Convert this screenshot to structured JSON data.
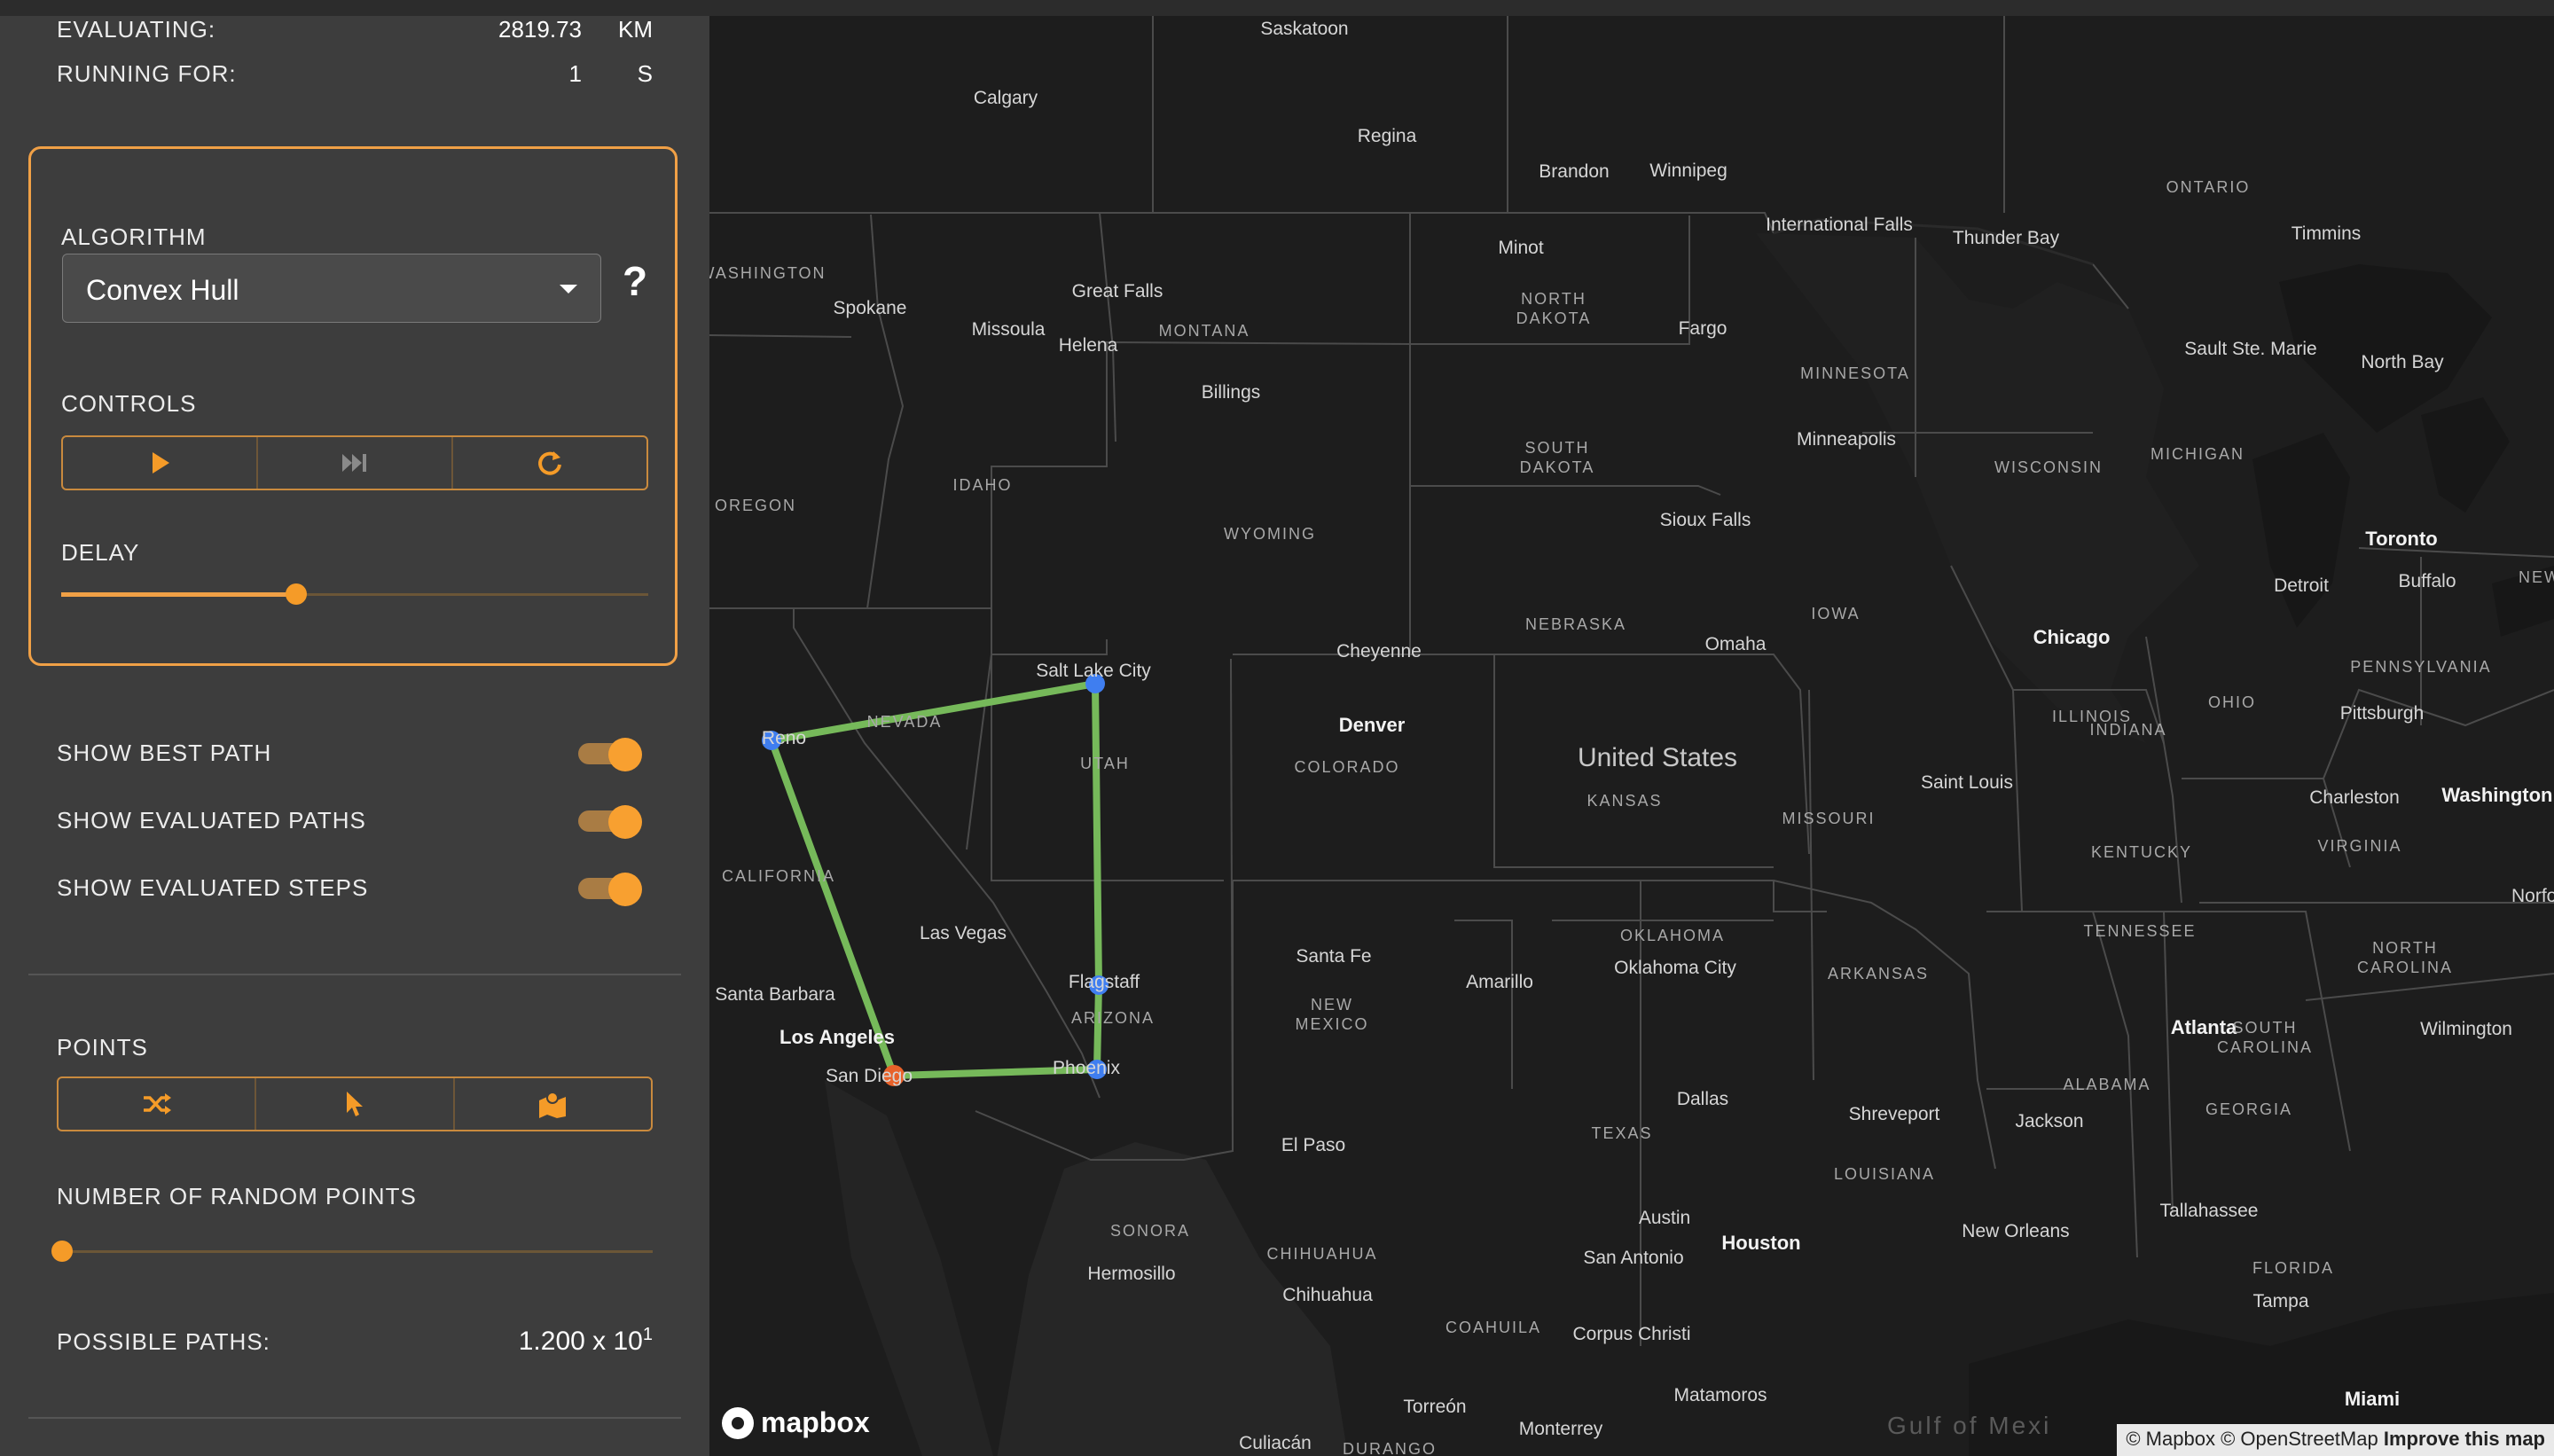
{
  "stats": {
    "evaluating_label": "EVALUATING:",
    "evaluating_value": "2819.73",
    "evaluating_unit": "KM",
    "running_label": "RUNNING FOR:",
    "running_value": "1",
    "running_unit": "S"
  },
  "algorithm": {
    "label": "ALGORITHM",
    "selected": "Convex Hull",
    "help": "?"
  },
  "controls": {
    "label": "CONTROLS",
    "buttons": [
      {
        "icon": "play-icon"
      },
      {
        "icon": "step-forward-icon"
      },
      {
        "icon": "restart-icon"
      }
    ]
  },
  "delay": {
    "label": "DELAY",
    "fraction": 0.4
  },
  "toggles": [
    {
      "label": "SHOW BEST PATH",
      "on": true
    },
    {
      "label": "SHOW EVALUATED PATHS",
      "on": true
    },
    {
      "label": "SHOW EVALUATED STEPS",
      "on": true
    }
  ],
  "points": {
    "label": "POINTS",
    "buttons": [
      {
        "icon": "shuffle-icon"
      },
      {
        "icon": "cursor-icon"
      },
      {
        "icon": "map-pins-icon"
      }
    ]
  },
  "random_points": {
    "label": "NUMBER OF RANDOM POINTS",
    "fraction": 0.0
  },
  "possible_paths": {
    "label": "POSSIBLE PATHS:",
    "mantissa": "1.200 x 10",
    "exponent": "1"
  },
  "map": {
    "country": "United States",
    "water": "Gulf of Mexi",
    "logo": "mapbox",
    "attribution": {
      "mapbox": "© Mapbox",
      "osm": "© OpenStreetMap",
      "improve": "Improve this map"
    },
    "cities": [
      "Saskatoon",
      "Calgary",
      "Regina",
      "Brandon",
      "Winnipeg",
      "Minot",
      "International Falls",
      "Thunder Bay",
      "Timmins",
      "Spokane",
      "Great Falls",
      "Missoula",
      "Helena",
      "Billings",
      "Fargo",
      "Sault Ste. Marie",
      "North Bay",
      "Minneapolis",
      "Sioux Falls",
      "Toronto",
      "Detroit",
      "Buffalo",
      "Salt Lake City",
      "Cheyenne",
      "Omaha",
      "Chicago",
      "Pittsburgh",
      "Denver",
      "Reno",
      "Saint Louis",
      "Charleston",
      "Washington D.",
      "Las Vegas",
      "Santa Fe",
      "Amarillo",
      "Oklahoma City",
      "Norfol",
      "Santa Barbara",
      "Flagstaff",
      "Los Angeles",
      "San Diego",
      "Phoenix",
      "Atlanta",
      "Wilmington",
      "Dallas",
      "Shreveport",
      "Jackson",
      "El Paso",
      "Tallahassee",
      "Austin",
      "Houston",
      "New Orleans",
      "San Antonio",
      "Hermosillo",
      "Chihuahua",
      "Tampa",
      "Corpus Christi",
      "Torreón",
      "Matamoros",
      "Miami",
      "Monterrey",
      "Culiacán"
    ],
    "states": [
      "WASHINGTON",
      "ONTARIO",
      "NORTH DAKOTA",
      "MONTANA",
      "MINNESOTA",
      "MICHIGAN",
      "WISCONSIN",
      "SOUTH DAKOTA",
      "IDAHO",
      "OREGON",
      "WYOMING",
      "NEBRASKA",
      "IOWA",
      "PENNSYLVANIA",
      "NEVADA",
      "UTAH",
      "ILLINOIS",
      "INDIANA",
      "OHIO",
      "COLORADO",
      "KANSAS",
      "MISSOURI",
      "CALIFORNIA",
      "KENTUCKY",
      "VIRGINIA",
      "TENNESSEE",
      "OKLAHOMA",
      "ARKANSAS",
      "NORTH CAROLINA",
      "NEW MEXICO",
      "ARIZONA",
      "SOUTH CAROLINA",
      "ALABAMA",
      "GEORGIA",
      "TEXAS",
      "LOUISIANA",
      "SONORA",
      "CHIHUAHUA",
      "FLORIDA",
      "COAHUILA",
      "DURANGO",
      "NEW"
    ]
  },
  "colors": {
    "accent": "#f0a046",
    "path": "#76b95a",
    "point": "#3f7ef0",
    "start_point": "#e8622a"
  }
}
